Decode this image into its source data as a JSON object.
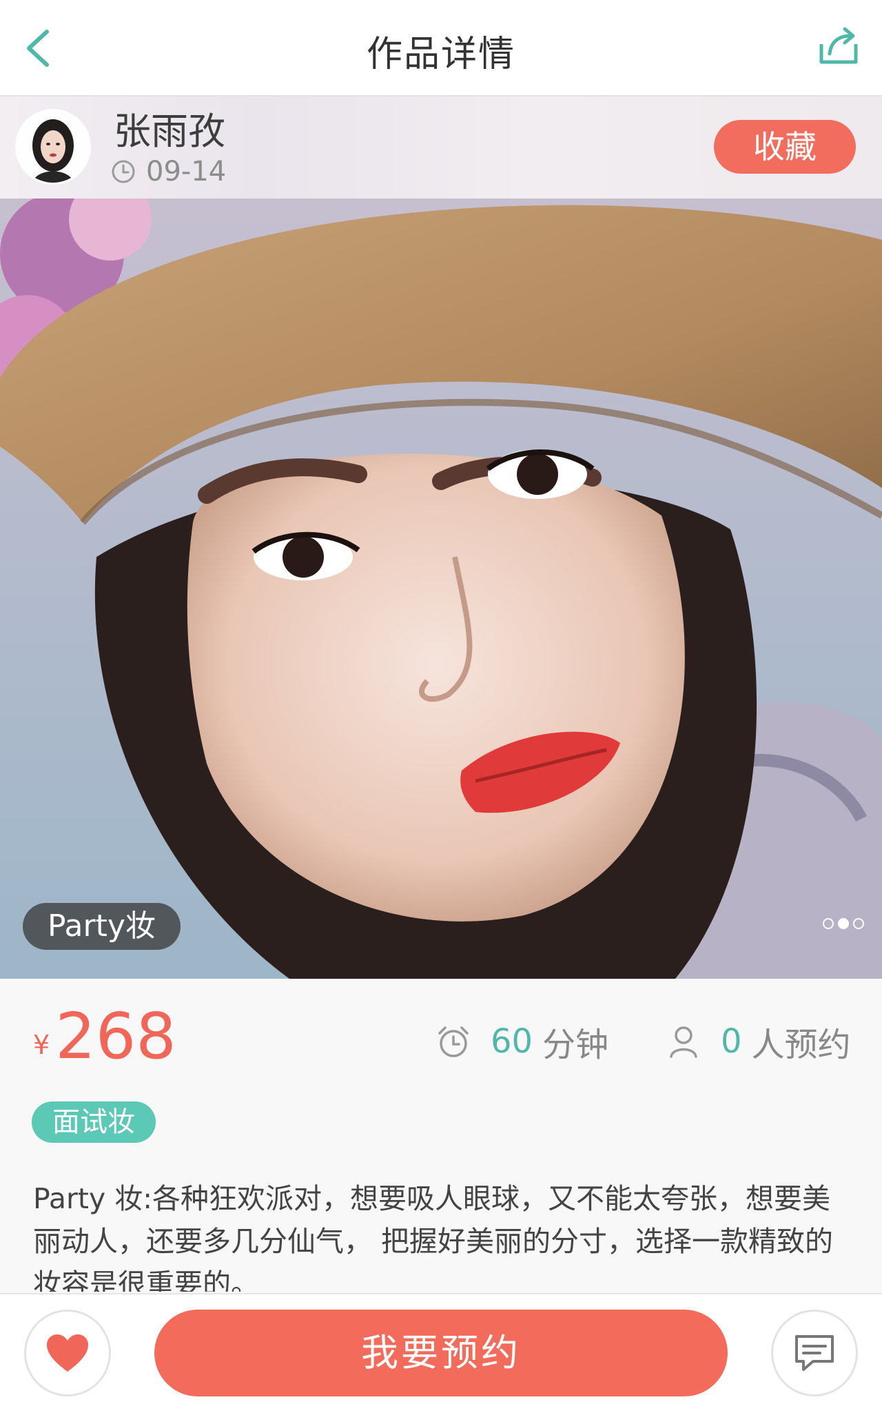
{
  "nav": {
    "title": "作品详情",
    "back_icon": "chevron-left-icon",
    "share_icon": "share-icon"
  },
  "author": {
    "name": "张雨孜",
    "date": "09-14",
    "favorite_label": "收藏"
  },
  "hero": {
    "style_tag": "Party妆",
    "carousel": {
      "total": 3,
      "active_index": 1
    }
  },
  "price": {
    "currency": "¥",
    "amount": "268"
  },
  "duration": {
    "value": "60",
    "unit": "分钟"
  },
  "bookings": {
    "value": "0",
    "unit": "人预约"
  },
  "category_tag": "面试妆",
  "description": "Party 妆:各种狂欢派对，想要吸人眼球，又不能太夸张，想要美丽动人，还要多几分仙气， 把握好美丽的分寸，选择一款精致的妆容是很重要的。",
  "bottom": {
    "book_label": "我要预约"
  },
  "colors": {
    "accent": "#f26b5b",
    "teal": "#4fb8a8",
    "tag_teal": "#5cc8b6"
  }
}
